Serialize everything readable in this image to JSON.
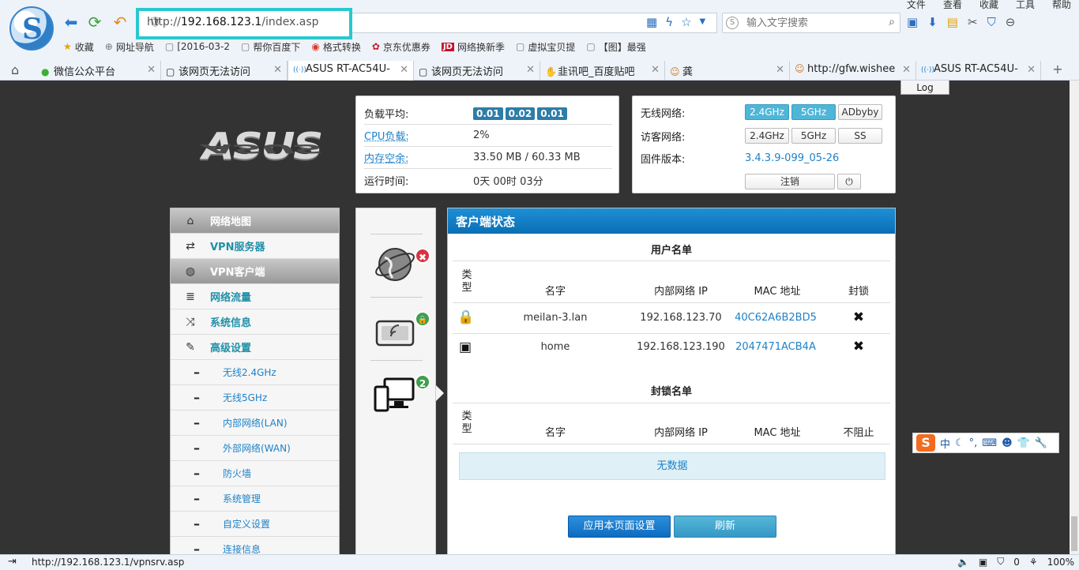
{
  "browser": {
    "logo_letter": "S",
    "menu": [
      "文件",
      "查看",
      "收藏",
      "工具",
      "帮助"
    ],
    "address_host": "192.168.123.1",
    "address_prefix": "http://",
    "address_path": "/index.asp",
    "search_placeholder": "输入文字搜索",
    "bookmarks": [
      {
        "icon": "★",
        "label": "收藏"
      },
      {
        "icon": "⊕",
        "label": "网址导航"
      },
      {
        "icon": "▢",
        "label": "[2016-03-2"
      },
      {
        "icon": "▢",
        "label": "帮你百度下"
      },
      {
        "icon": "◉",
        "label": "格式转换"
      },
      {
        "icon": "✿",
        "label": "京东优惠券"
      },
      {
        "icon": "JD",
        "label": "网络换新季"
      },
      {
        "icon": "▢",
        "label": "虚拟宝贝提"
      },
      {
        "icon": "▢",
        "label": "【图】最强"
      }
    ],
    "tabs": [
      {
        "label": "微信公众平台",
        "icon": "●"
      },
      {
        "label": "该网页无法访问",
        "icon": "▢"
      },
      {
        "label": "ASUS RT-AC54U-",
        "icon": "((·))"
      },
      {
        "label": "该网页无法访问",
        "icon": "▢"
      },
      {
        "label": "韭讯吧_百度贴吧",
        "icon": "✋"
      },
      {
        "label": "龚",
        "icon": "☺"
      },
      {
        "label": "http://gfw.wishee",
        "icon": "☺"
      },
      {
        "label": "ASUS RT-AC54U-",
        "icon": "((·))"
      }
    ],
    "new_tab": "+",
    "status_url": "http://192.168.123.1/vpnsrv.asp",
    "status_zero": "0",
    "zoom": "100%"
  },
  "router": {
    "log_tab": "Log",
    "logo_text": "ASUS",
    "sys": {
      "load_label": "负载平均:",
      "load_values": [
        "0.01",
        "0.02",
        "0.01"
      ],
      "cpu_label": "CPU负载:",
      "cpu_value": "2%",
      "mem_label": "内存空余:",
      "mem_value": "33.50 MB / 60.33 MB",
      "uptime_label": "运行时间:",
      "uptime_value": "0天 00时 03分"
    },
    "wifi": {
      "wireless_label": "无线网络:",
      "wireless_btns": [
        "2.4GHz",
        "5GHz",
        "ADbyby"
      ],
      "guest_label": "访客网络:",
      "guest_btns": [
        "2.4GHz",
        "5GHz",
        "SS"
      ],
      "firmware_label": "固件版本:",
      "firmware_value": "3.4.3.9-099_05-26",
      "logout_label": "注销",
      "power_icon": "⏻"
    },
    "menu": [
      {
        "label": "网络地图",
        "icon": "⌂",
        "name": "network-map"
      },
      {
        "label": "VPN服务器",
        "icon": "⇄",
        "name": "vpn-server"
      },
      {
        "label": "VPN客户端",
        "icon": "◍",
        "name": "vpn-client"
      },
      {
        "label": "网络流量",
        "icon": "≣",
        "name": "traffic"
      },
      {
        "label": "系统信息",
        "icon": "⤨",
        "name": "system-info"
      },
      {
        "label": "高级设置",
        "icon": "✎",
        "name": "advanced"
      }
    ],
    "submenu": [
      "无线2.4GHz",
      "无线5GHz",
      "内部网络(LAN)",
      "外部网络(WAN)",
      "防火墙",
      "系统管理",
      "自定义设置",
      "连接信息"
    ],
    "submenu_dash": "–",
    "mid_badges": {
      "internet": "✖",
      "wireless": "🔒",
      "clients": "2"
    },
    "client": {
      "title": "客户端状态",
      "user_list_title": "用户名单",
      "block_list_title": "封锁名单",
      "headers": {
        "type": "类型",
        "name": "名字",
        "ip": "内部网络 IP",
        "mac": "MAC 地址",
        "block": "封锁",
        "unblock": "不阻止"
      },
      "rows": [
        {
          "type_icon": "🔒",
          "name": "meilan-3.lan",
          "ip": "192.168.123.70",
          "mac": "40C62A6B2BD5",
          "block_icon": "✖"
        },
        {
          "type_icon": "▣",
          "name": "home",
          "ip": "192.168.123.190",
          "mac": "2047471ACB4A",
          "block_icon": "✖"
        }
      ],
      "no_data": "无数据",
      "apply_label": "应用本页面设置",
      "refresh_label": "刷新"
    },
    "ime": {
      "logo": "S",
      "mode": "中"
    }
  }
}
